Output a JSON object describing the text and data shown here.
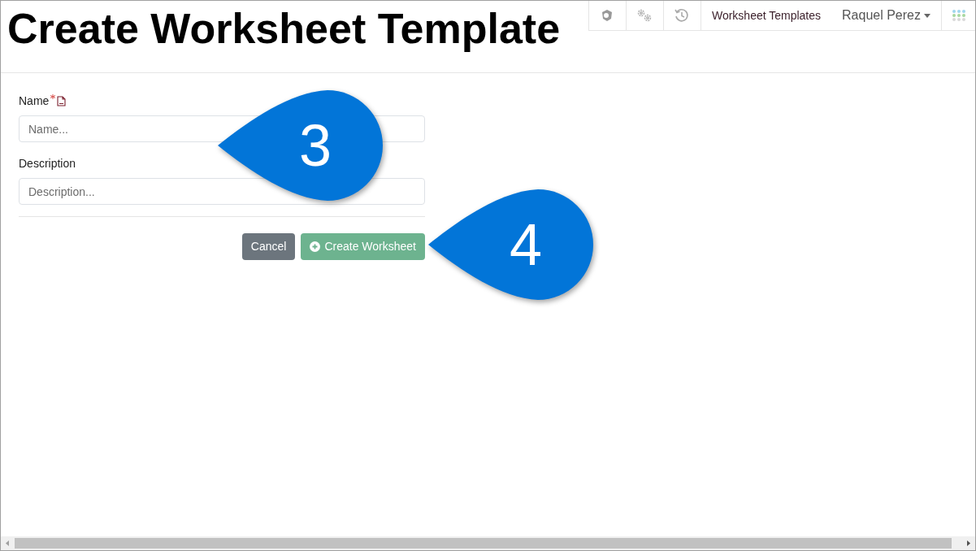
{
  "title": "Create Worksheet Template",
  "nav": {
    "link": "Worksheet Templates",
    "user": "Raquel Perez"
  },
  "form": {
    "fields": [
      {
        "label": "Name",
        "required": true,
        "placeholder": "Name..."
      },
      {
        "label": "Description",
        "required": false,
        "placeholder": "Description..."
      }
    ],
    "buttons": [
      {
        "label": "Cancel",
        "kind": "secondary"
      },
      {
        "label": "Create Worksheet",
        "kind": "primary"
      }
    ]
  },
  "callouts": [
    "3",
    "4"
  ]
}
